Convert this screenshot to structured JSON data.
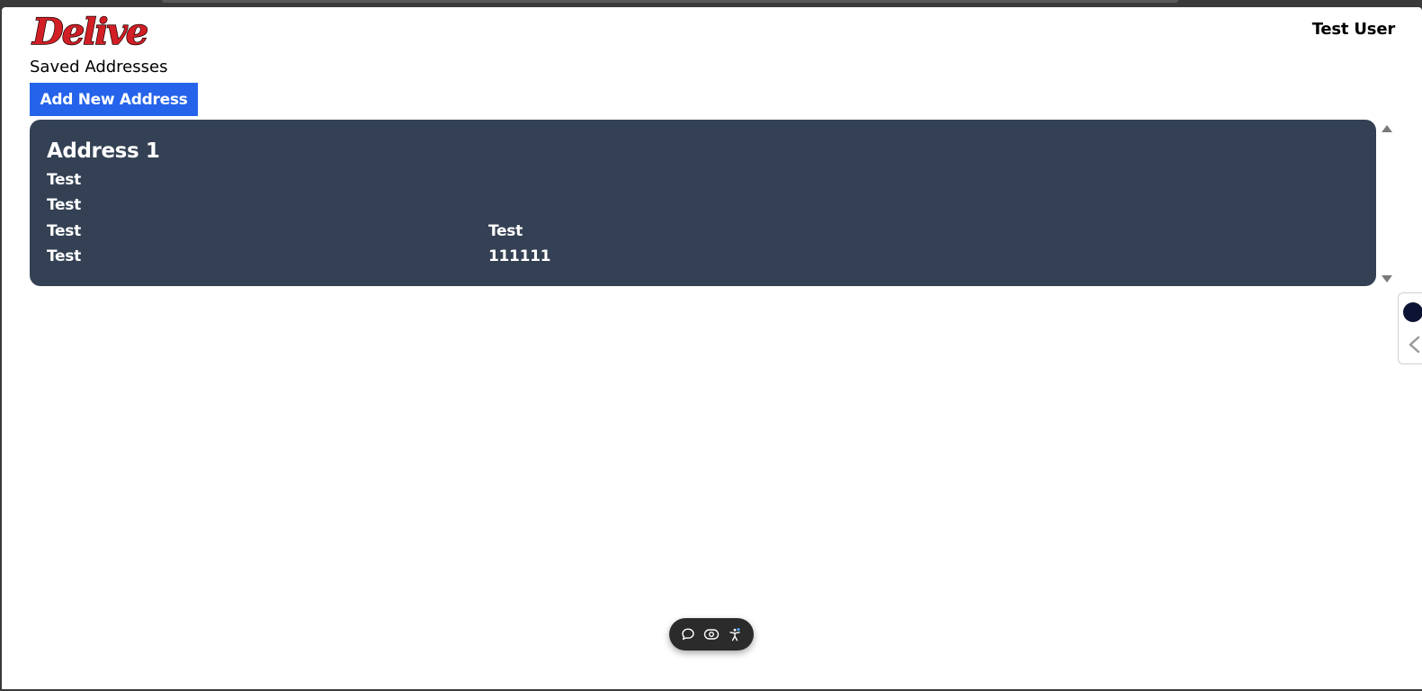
{
  "app": {
    "logo_text": "Delivered",
    "user_name": "Test User"
  },
  "page": {
    "title": "Saved Addresses",
    "add_button_label": "Add New Address"
  },
  "addresses": [
    {
      "title": "Address 1",
      "line1": "Test",
      "line2": "Test",
      "city": "Test",
      "state": "Test",
      "country": "Test",
      "pincode": "111111"
    }
  ],
  "colors": {
    "accent": "#2563eb",
    "card_bg": "#344154",
    "logo_red": "#d21f26"
  },
  "toolbar": {
    "icons": [
      "chat-bubble-icon",
      "eye-icon",
      "accessibility-icon"
    ]
  }
}
